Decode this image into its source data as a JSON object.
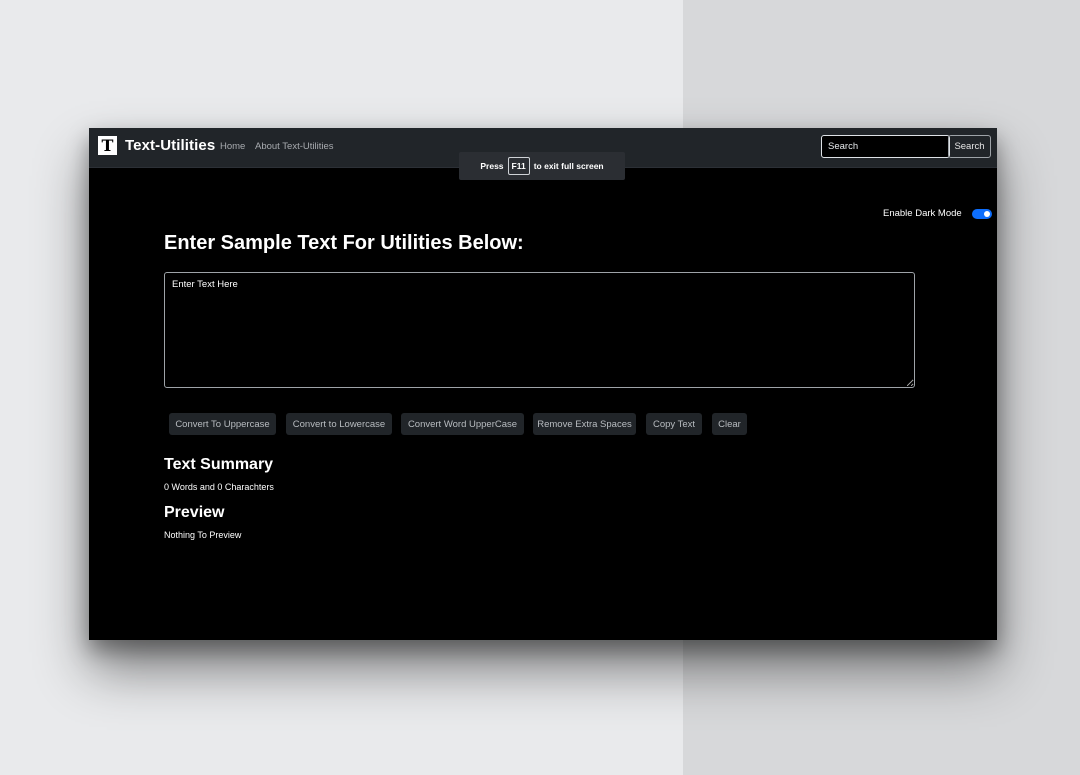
{
  "navbar": {
    "logo_letter": "T",
    "brand": "Text-Utilities",
    "links": [
      "Home",
      "About Text-Utilities"
    ],
    "search_placeholder": "Search",
    "search_button": "Search"
  },
  "fullscreen_notice": {
    "prefix": "Press",
    "key": "F11",
    "suffix": "to exit full screen"
  },
  "dark_mode": {
    "label": "Enable Dark Mode",
    "enabled": true
  },
  "main": {
    "heading": "Enter Sample Text For Utilities Below:",
    "textarea_placeholder": "Enter Text Here",
    "textarea_value": "",
    "buttons": [
      "Convert To Uppercase",
      "Convert to Lowercase",
      "Convert Word UpperCase",
      "Remove Extra Spaces",
      "Copy Text",
      "Clear"
    ]
  },
  "summary": {
    "title": "Text Summary",
    "text": "0 Words and 0 Charachters"
  },
  "preview": {
    "title": "Preview",
    "text": "Nothing To Preview"
  },
  "colors": {
    "accent": "#0d6efd",
    "navbar_bg": "#212529",
    "page_bg": "#000000",
    "button_bg": "#212529"
  }
}
